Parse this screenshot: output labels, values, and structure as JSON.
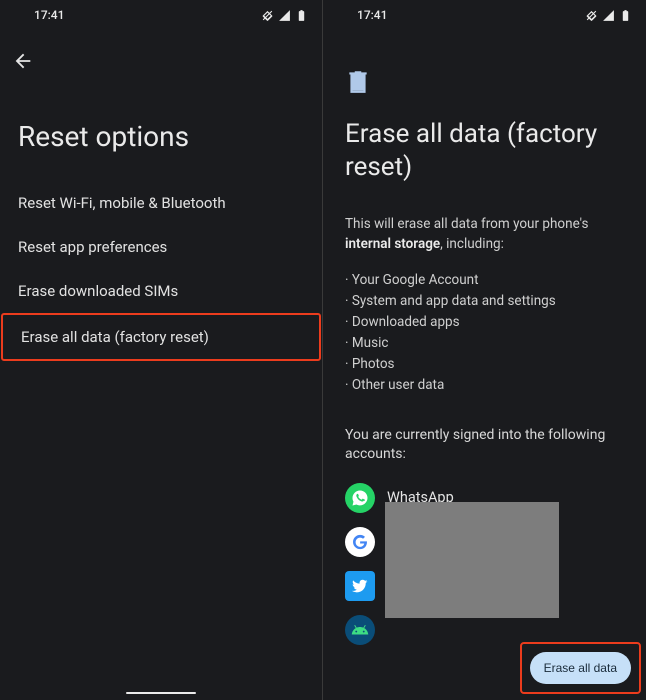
{
  "status": {
    "time": "17:41"
  },
  "left": {
    "title": "Reset options",
    "items": [
      "Reset Wi-Fi, mobile & Bluetooth",
      "Reset app preferences",
      "Erase downloaded SIMs",
      "Erase all data (factory reset)"
    ]
  },
  "right": {
    "title": "Erase all data (factory reset)",
    "desc_pre": "This will erase all data from your phone's ",
    "desc_bold": "internal storage",
    "desc_post": ", including:",
    "bullets": [
      "Your Google Account",
      "System and app data and settings",
      "Downloaded apps",
      "Music",
      "Photos",
      "Other user data"
    ],
    "signed": "You are currently signed into the following accounts:",
    "accounts": [
      {
        "name": "WhatsApp",
        "kind": "whatsapp"
      },
      {
        "name": "",
        "kind": "google"
      },
      {
        "name": "",
        "kind": "twitter"
      },
      {
        "name": "",
        "kind": "android"
      }
    ],
    "cta": "Erase all data"
  }
}
